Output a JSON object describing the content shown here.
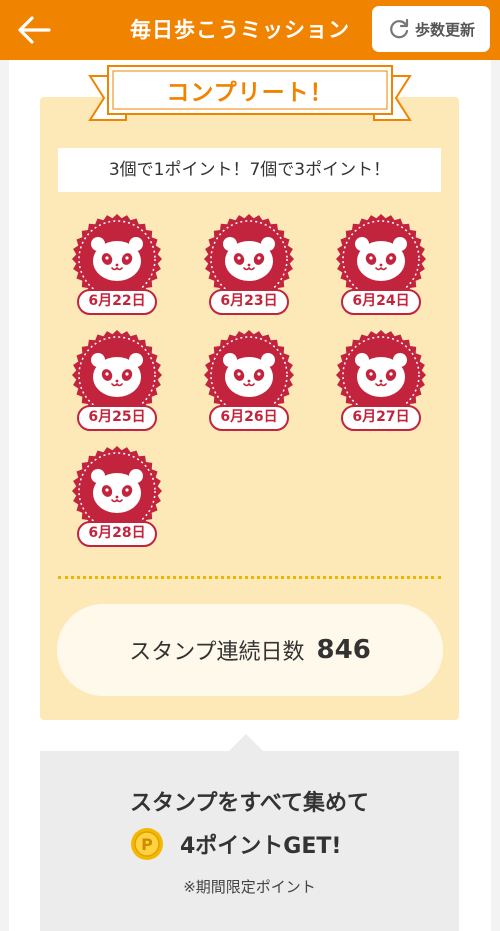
{
  "header": {
    "title": "毎日歩こうミッション",
    "refresh_label": "歩数更新",
    "back_icon": "arrow-left-icon",
    "refresh_icon": "refresh-icon"
  },
  "mission": {
    "complete_banner": "コンプリート！",
    "rule_text": "3個で1ポイント！7個で3ポイント！",
    "stamps": [
      {
        "date": "6月22日"
      },
      {
        "date": "6月23日"
      },
      {
        "date": "6月24日"
      },
      {
        "date": "6月25日"
      },
      {
        "date": "6月26日"
      },
      {
        "date": "6月27日"
      },
      {
        "date": "6月28日"
      }
    ],
    "streak_label": "スタンプ連続日数",
    "streak_value": "846"
  },
  "reward": {
    "title": "スタンプをすべて集めて",
    "points_text": "4ポイントGET!",
    "note": "※期間限定ポイント",
    "coin_icon": "point-coin-icon"
  },
  "colors": {
    "accent": "#f08300",
    "stamp_red": "#c2243d",
    "card_bg": "#fde8b8"
  }
}
